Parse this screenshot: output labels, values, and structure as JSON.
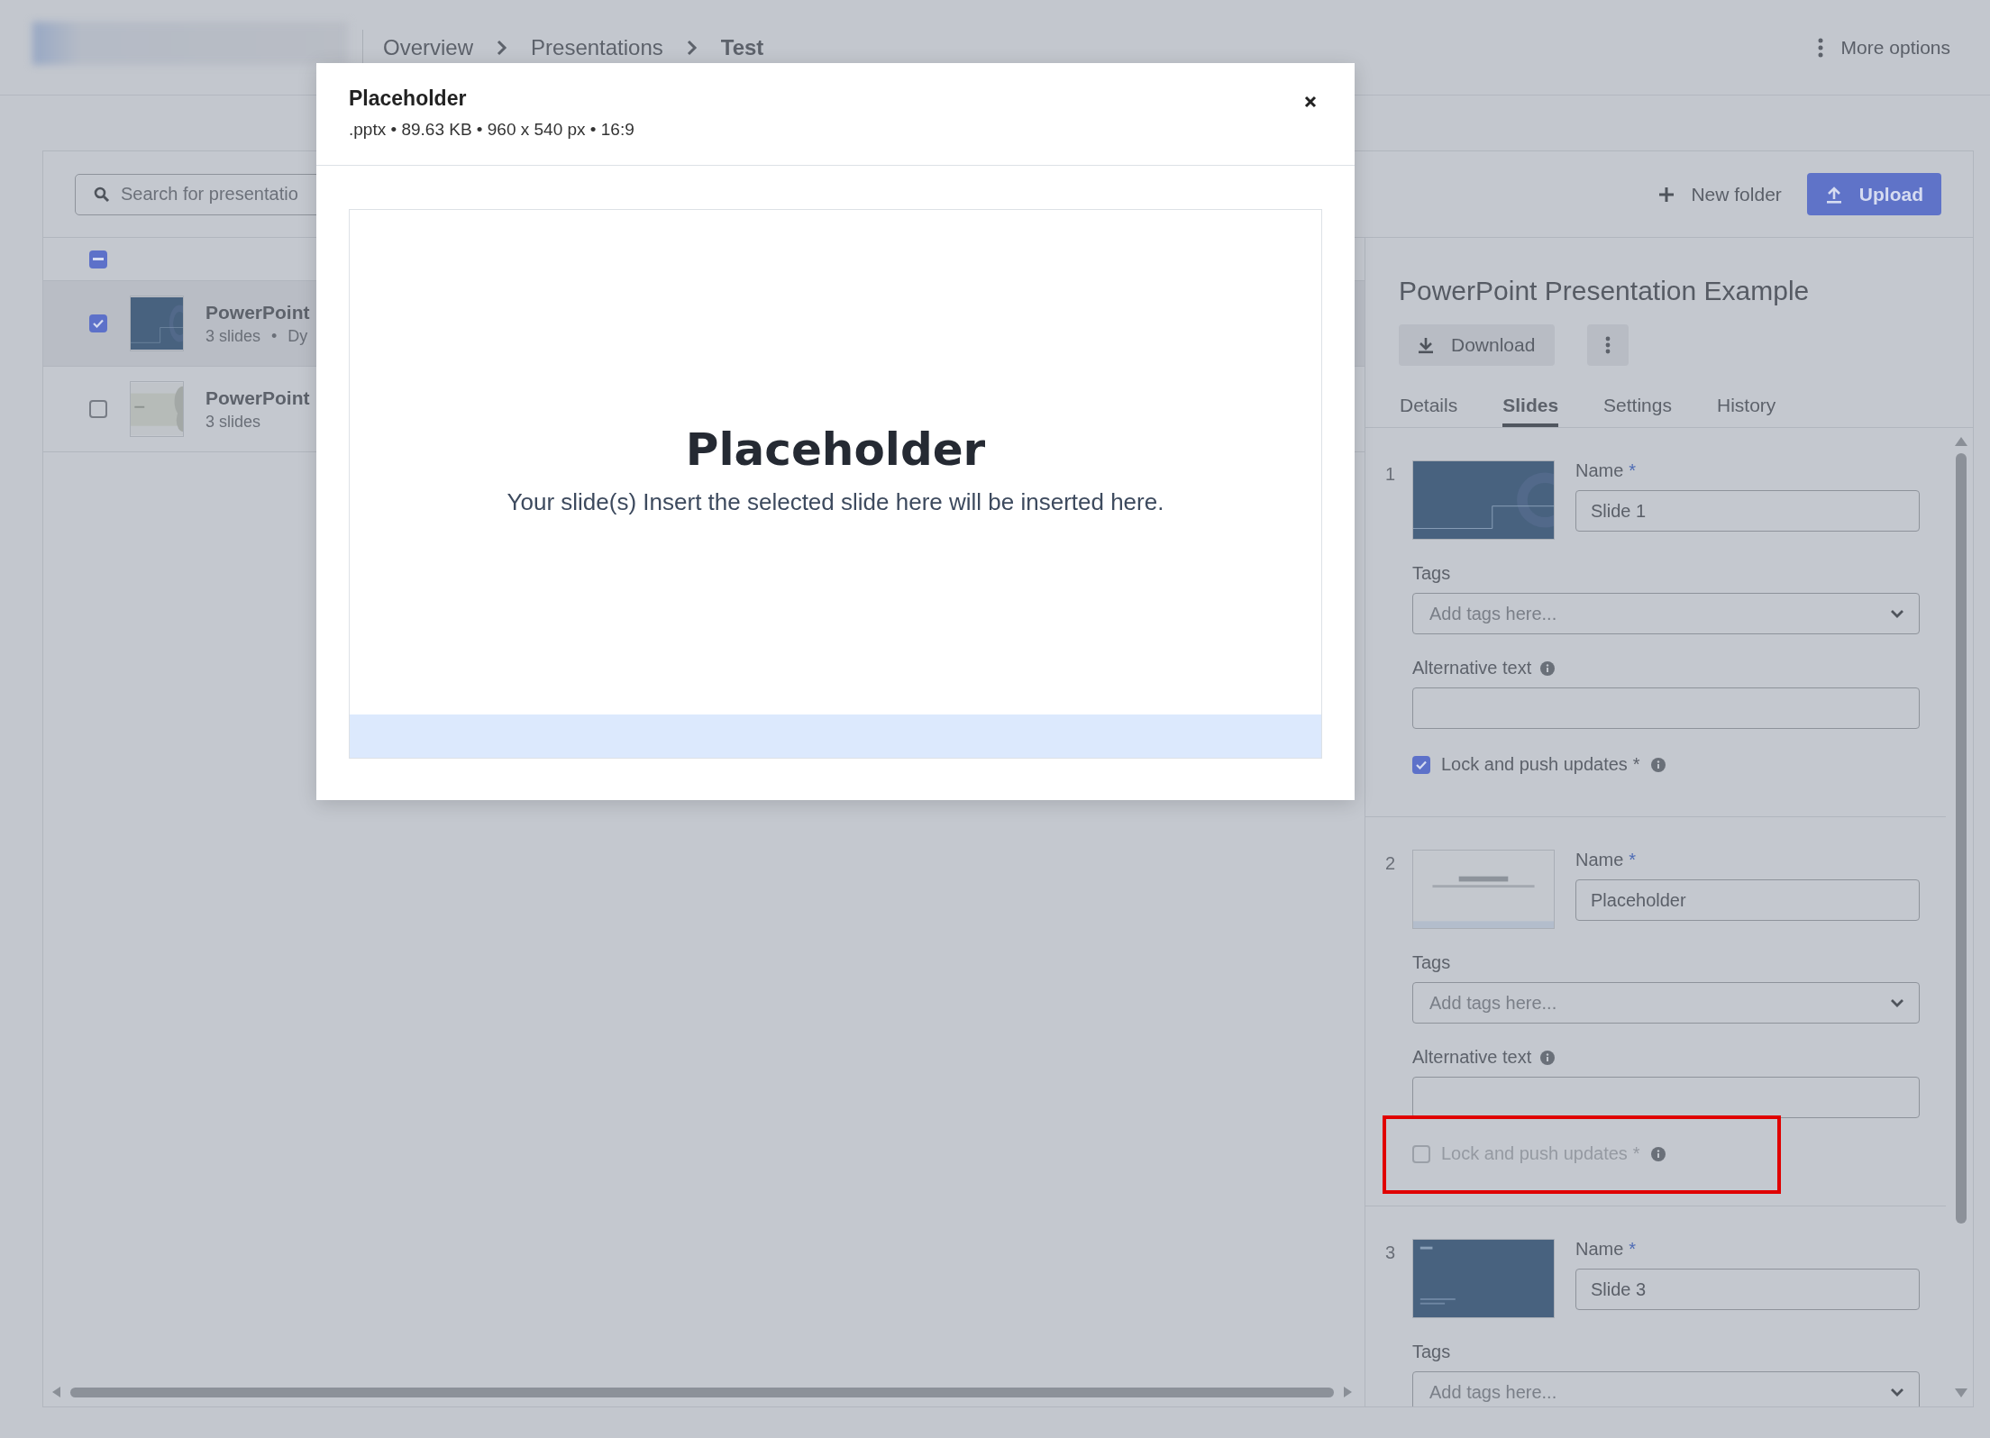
{
  "header": {
    "breadcrumbs": [
      {
        "label": "Overview",
        "current": false
      },
      {
        "label": "Presentations",
        "current": false
      },
      {
        "label": "Test",
        "current": true
      }
    ],
    "more_options": "More options"
  },
  "toolbar": {
    "search": {
      "placeholder": "Search for presentatio"
    },
    "new_folder": "New folder",
    "upload": "Upload"
  },
  "list": {
    "select_all_partial": true,
    "rows": [
      {
        "title": "PowerPoint",
        "meta": [
          "3 slides",
          "Dy"
        ],
        "separator": "•",
        "selected": true,
        "thumbnail": {
          "kind": "dark"
        }
      },
      {
        "title": "PowerPoint",
        "meta": [
          "3 slides"
        ],
        "selected": false,
        "thumbnail": {
          "kind": "light"
        }
      }
    ]
  },
  "details": {
    "title": "PowerPoint Presentation Example",
    "download": "Download",
    "tabs": [
      {
        "label": "Details",
        "selected": false
      },
      {
        "label": "Slides",
        "selected": true
      },
      {
        "label": "Settings",
        "selected": false
      },
      {
        "label": "History",
        "selected": false
      }
    ],
    "slides": [
      {
        "number": "1",
        "thumbnail": {
          "kind": "dark"
        },
        "name_label": "Name",
        "name_required": "*",
        "name": "Slide 1",
        "tags_label": "Tags",
        "tags_placeholder": "Add tags here...",
        "alt_label": "Alternative text",
        "lock_label": "Lock and push updates",
        "lock_required": "*",
        "locked": true,
        "disabled": false,
        "highlighted": false
      },
      {
        "number": "2",
        "thumbnail": {
          "kind": "placeholder"
        },
        "name_label": "Name",
        "name_required": "*",
        "name": "Placeholder",
        "tags_label": "Tags",
        "tags_placeholder": "Add tags here...",
        "alt_label": "Alternative text",
        "lock_label": "Lock and push updates",
        "lock_required": "*",
        "locked": false,
        "disabled": true,
        "highlighted": true
      },
      {
        "number": "3",
        "thumbnail": {
          "kind": "title"
        },
        "name_label": "Name",
        "name_required": "*",
        "name": "Slide 3",
        "tags_label": "Tags",
        "tags_placeholder": "Add tags here..."
      }
    ]
  },
  "modal": {
    "title": "Placeholder",
    "meta": ".pptx • 89.63 KB • 960 x 540 px • 16:9",
    "preview": {
      "heading": "Placeholder",
      "text": "Your slide(s) Insert the selected slide here will be inserted here."
    }
  }
}
